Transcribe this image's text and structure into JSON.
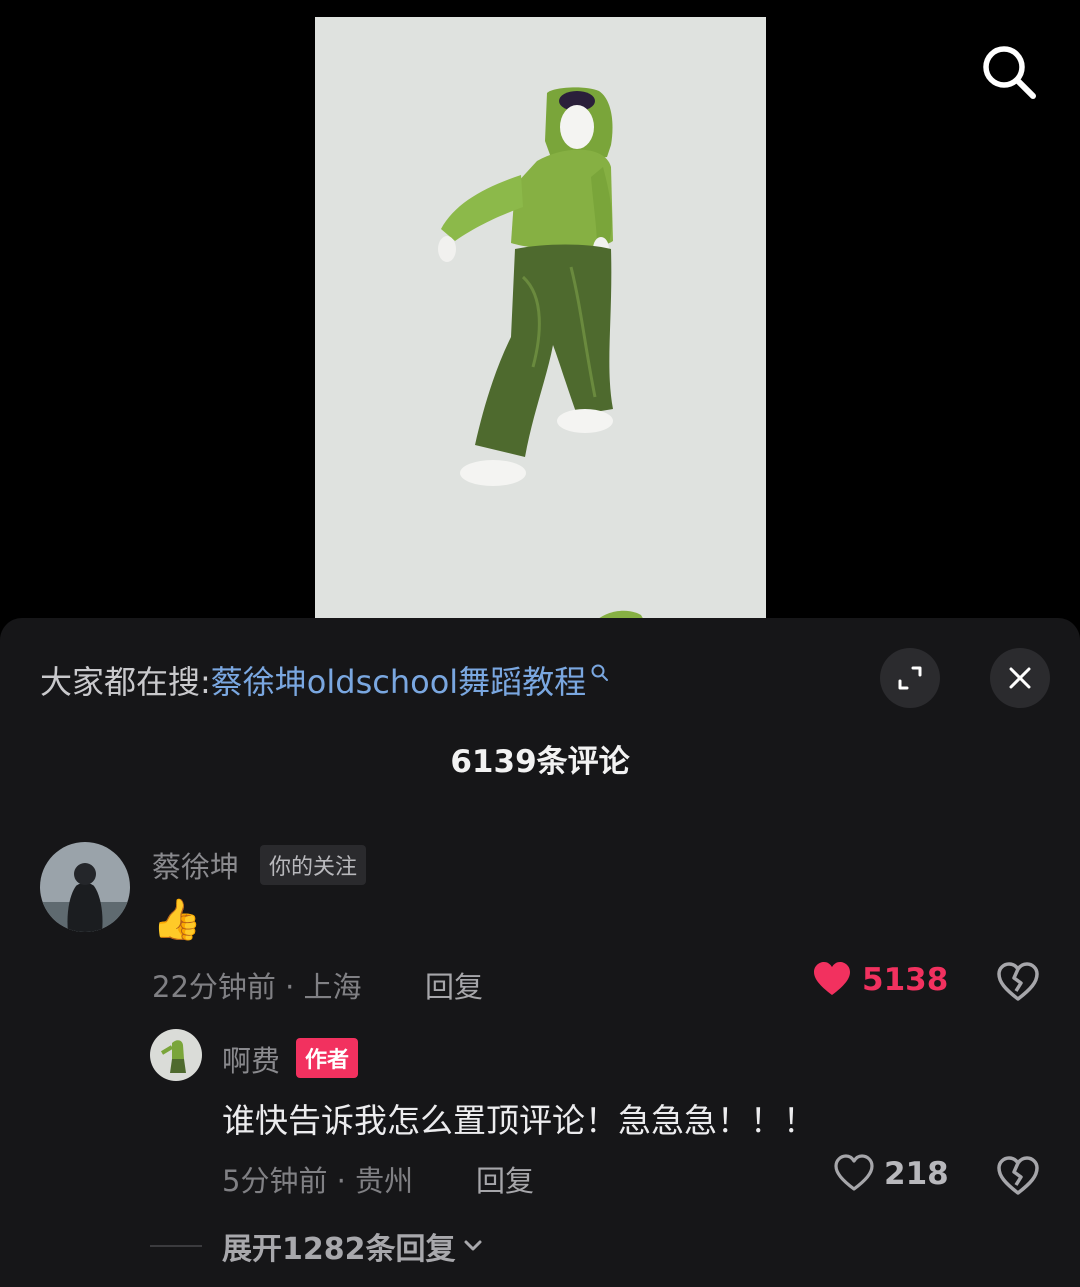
{
  "search_suggestion": {
    "prefix": "大家都在搜:",
    "query": "蔡徐坤oldschool舞蹈教程"
  },
  "comment_count_label": "6139条评论",
  "comments": [
    {
      "author": "蔡徐坤",
      "tag": "你的关注",
      "content_emoji": "👍",
      "meta": "22分钟前 · 上海",
      "reply_label": "回复",
      "likes": "5138",
      "liked": true,
      "replies": [
        {
          "author": "啊费",
          "tag": "作者",
          "content": "谁快告诉我怎么置顶评论！急急急！！！",
          "meta": "5分钟前 · 贵州",
          "reply_label": "回复",
          "likes": "218",
          "liked": false
        }
      ],
      "expand_label": "展开1282条回复"
    }
  ],
  "colors": {
    "like_active": "#f2315f",
    "link_blue": "#7aa7e0",
    "sheet_bg": "#161618"
  },
  "icons": [
    "search-icon",
    "expand-icon",
    "close-icon",
    "heart-icon",
    "broken-heart-icon",
    "chevron-down-icon"
  ]
}
